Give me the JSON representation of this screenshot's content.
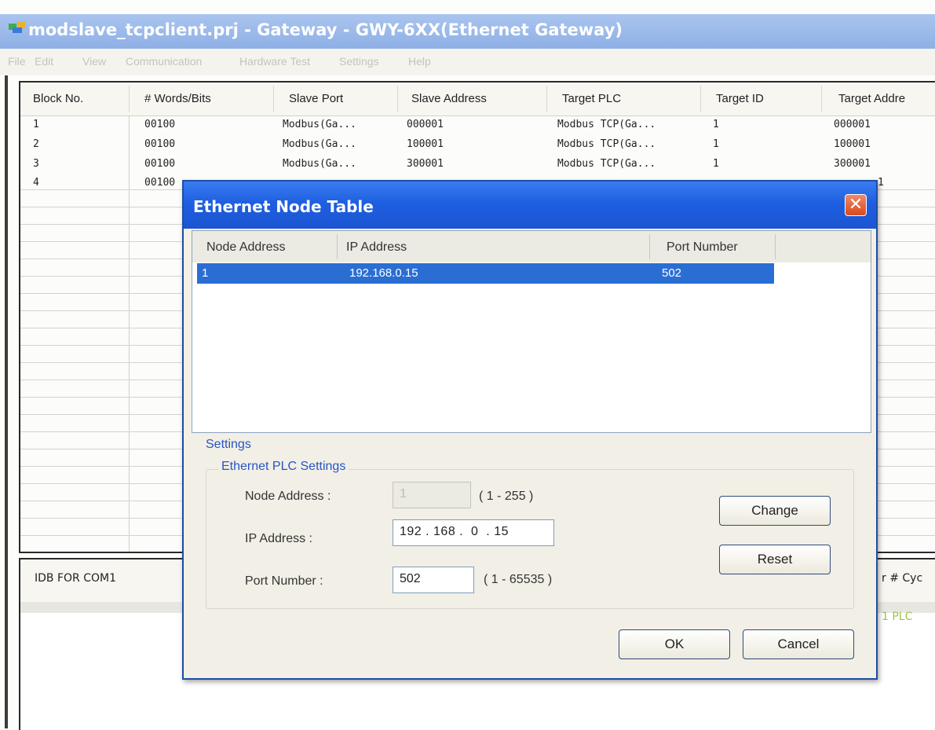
{
  "window": {
    "title": "modslave_tcpclient.prj - Gateway - GWY-6XX(Ethernet Gateway)",
    "menu": [
      "File",
      "Edit",
      "View",
      "Communication",
      "Hardware Test",
      "Settings",
      "Help"
    ]
  },
  "grid": {
    "columns": [
      "Block No.",
      "# Words/Bits",
      "Slave Port",
      "Slave Address",
      "Target PLC",
      "Target ID",
      "Target Addre"
    ],
    "rows": [
      [
        "1",
        "00100",
        "Modbus(Ga...",
        "000001",
        "Modbus TCP(Ga...",
        "1",
        "000001"
      ],
      [
        "2",
        "00100",
        "Modbus(Ga...",
        "100001",
        "Modbus TCP(Ga...",
        "1",
        "100001"
      ],
      [
        "3",
        "00100",
        "Modbus(Ga...",
        "300001",
        "Modbus TCP(Ga...",
        "1",
        "300001"
      ],
      [
        "4",
        "00100",
        "",
        "",
        "",
        "",
        "1"
      ]
    ]
  },
  "bottom_pane": {
    "tab_label": "IDB FOR COM1",
    "right_header": "r # Cyc",
    "status_text": "1 PLC"
  },
  "dialog": {
    "title": "Ethernet Node Table",
    "close_glyph": "✕",
    "list_columns": [
      "Node Address",
      "IP Address",
      "Port Number"
    ],
    "list_rows": [
      [
        "1",
        "192.168.0.15",
        "502"
      ]
    ],
    "settings_label": "Settings",
    "group_label": "Ethernet PLC Settings",
    "node_address_label": "Node Address :",
    "node_address_value": "1",
    "node_address_range": "( 1 - 255 )",
    "ip_address_label": "IP Address :",
    "ip_address_value": "192 . 168 .  0  . 15",
    "port_number_label": "Port Number :",
    "port_number_value": "502",
    "port_number_range": "( 1 - 65535 )",
    "change_button": "Change",
    "reset_button": "Reset",
    "ok_button": "OK",
    "cancel_button": "Cancel"
  },
  "colors": {
    "title_bar": "#8fb0e6",
    "dialog_title": "#1e5fe0",
    "selection": "#2a6ed4",
    "group_label": "#2656c4"
  }
}
